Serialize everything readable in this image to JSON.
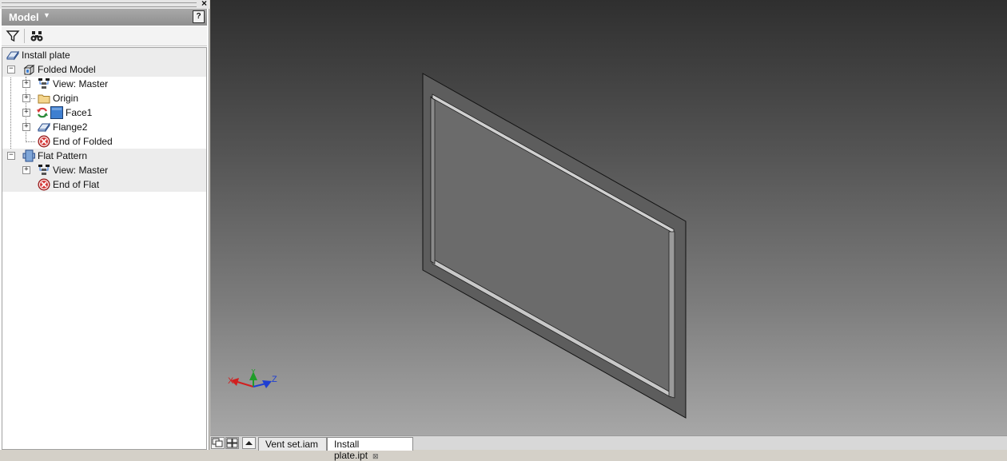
{
  "browser": {
    "title": "Model",
    "help_label": "?",
    "close_label": "×"
  },
  "tree": {
    "root": "Install plate",
    "folded_model": "Folded Model",
    "folded_view": "View: Master",
    "origin": "Origin",
    "face1": "Face1",
    "flange2": "Flange2",
    "end_of_folded": "End of Folded",
    "flat_pattern": "Flat Pattern",
    "flat_view": "View: Master",
    "end_of_flat": "End of Flat"
  },
  "tabs": {
    "vent_set": "Vent set.iam",
    "install_plate": "Install plate.ipt",
    "tab_close": "⊠"
  },
  "triad": {
    "x": "X",
    "y": "Y",
    "z": "Z"
  },
  "colors": {
    "x_axis": "#d21f1f",
    "y_axis": "#1f9d2a",
    "z_axis": "#1f3fd2",
    "face_blue": "#3f7fd0",
    "end_marker": "#d63a3a"
  }
}
